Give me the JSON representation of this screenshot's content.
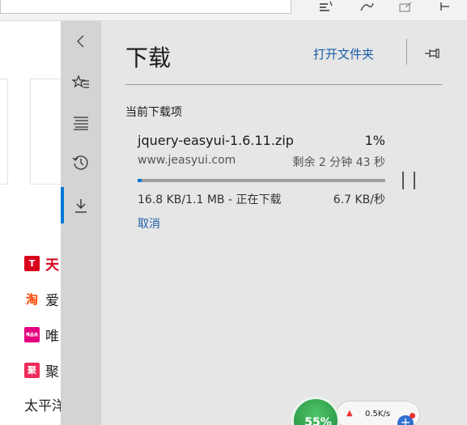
{
  "panel": {
    "title": "下载",
    "open_folder": "打开文件夹",
    "section_label": "当前下载项"
  },
  "download": {
    "filename": "jquery-easyui-1.6.11.zip",
    "percent_label": "1%",
    "progress": 0.01,
    "site": "www.jeasyui.com",
    "remaining": "剩余 2 分钟 43 秒",
    "size_status": "16.8 KB/1.1 MB - 正在下载",
    "speed": "6.7 KB/秒",
    "cancel": "取消"
  },
  "background_sites": [
    {
      "text": "天",
      "icon_text": "T",
      "icon_color": "#d8001b",
      "text_color": "#d8001b"
    },
    {
      "text": "爱",
      "icon_text": "淘",
      "icon_color": "#ffffff",
      "text_color": "#222222",
      "icon_glyph_color": "#ff4400"
    },
    {
      "text": "唯",
      "icon_text": "唯品会",
      "icon_color": "#e4007f",
      "text_color": "#222222"
    },
    {
      "text": "聚",
      "icon_text": "聚",
      "icon_color": "#ee2a5b",
      "text_color": "#222222"
    },
    {
      "text": "太平洋",
      "icon_text": "",
      "icon_color": "",
      "text_color": "#222222"
    }
  ],
  "widget": {
    "percent": "55%",
    "speed": "0.5K/s"
  },
  "colors": {
    "accent": "#0078d7",
    "link": "#1a5fa8",
    "panel_bg": "#e6e6e6",
    "rail_bg": "#d4d4d4"
  },
  "icons": {
    "rail": [
      "chevron-left-icon",
      "favorites-icon",
      "reading-list-icon",
      "history-icon",
      "download-icon"
    ],
    "header": [
      "pin-icon"
    ]
  }
}
